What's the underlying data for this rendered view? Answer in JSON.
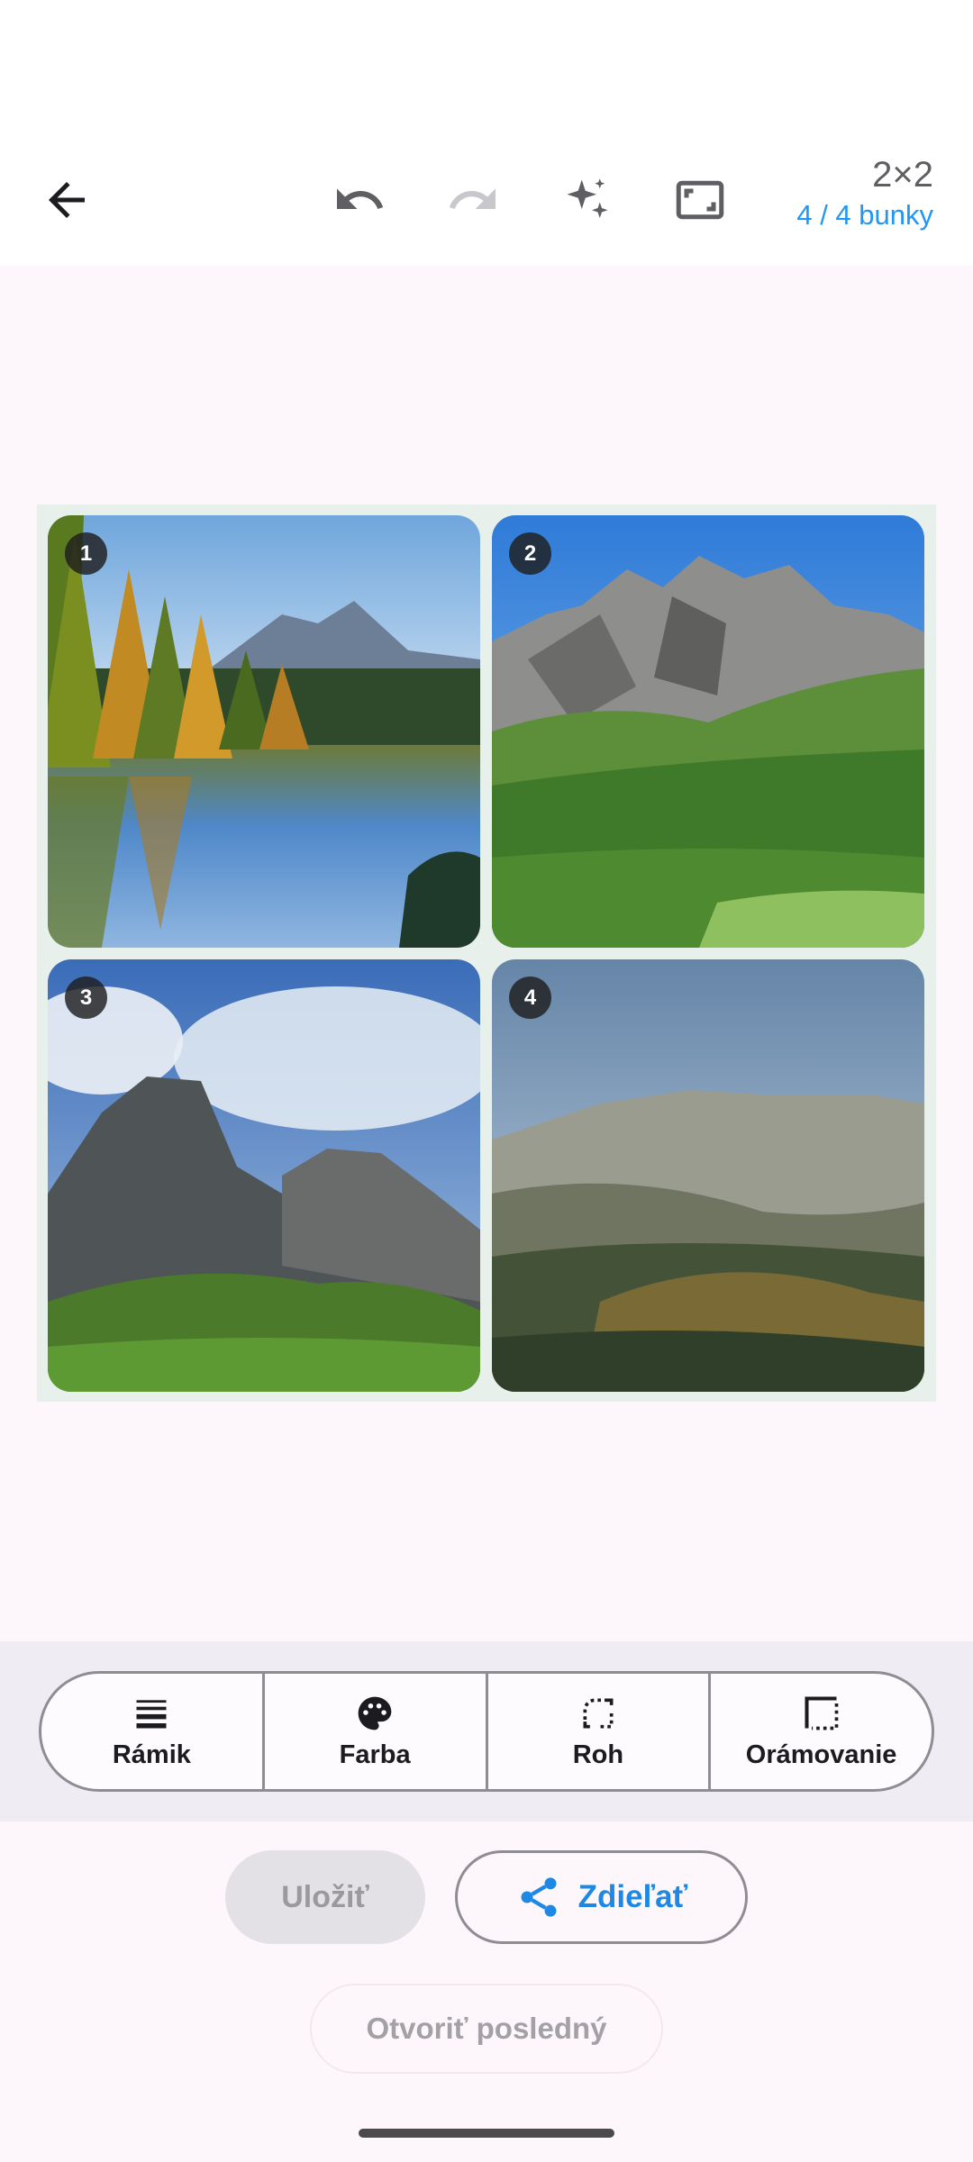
{
  "toolbar": {
    "back_icon": "arrow-back-icon",
    "undo_icon": "undo-icon",
    "redo_icon": "redo-icon",
    "magic_icon": "sparkles-icon",
    "aspect_icon": "aspect-ratio-icon",
    "grid_label": "2×2",
    "cells_label": "4 / 4 bunky"
  },
  "collage": {
    "cells": [
      {
        "badge": "1",
        "scene": "lake-reflection-mountains"
      },
      {
        "badge": "2",
        "scene": "rocky-peaks-blue-sky"
      },
      {
        "badge": "3",
        "scene": "dark-peaks-clouds"
      },
      {
        "badge": "4",
        "scene": "mountain-slope-larch"
      }
    ],
    "background_color": "#e8f0ec"
  },
  "tools": [
    {
      "label": "Rámik",
      "icon": "border-width-icon"
    },
    {
      "label": "Farba",
      "icon": "palette-icon"
    },
    {
      "label": "Roh",
      "icon": "rounded-corner-icon"
    },
    {
      "label": "Orámovanie",
      "icon": "frame-padding-icon"
    }
  ],
  "actions": {
    "save_label": "Uložiť",
    "share_label": "Zdieľať",
    "share_icon": "share-icon",
    "open_last_label": "Otvoriť posledný"
  },
  "colors": {
    "accent": "#1e88e5",
    "background": "#fdf7fc"
  }
}
